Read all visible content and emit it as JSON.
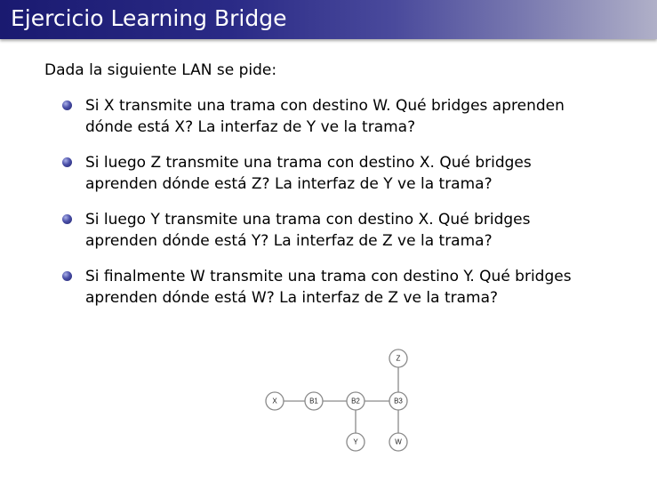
{
  "slide": {
    "title": "Ejercicio Learning Bridge",
    "intro": "Dada la siguiente LAN se pide:",
    "questions": [
      {
        "line1": "Si X transmite una trama con destino W. Qué bridges aprenden",
        "line2": "dónde está X? La interfaz de Y ve la trama?"
      },
      {
        "line1": "Si luego Z transmite una trama con destino X. Qué bridges",
        "line2": "aprenden dónde está Z? La interfaz de Y ve la trama?"
      },
      {
        "line1": "Si luego Y transmite una trama con destino X. Qué bridges",
        "line2": "aprenden dónde está Y? La interfaz de Z ve la trama?"
      },
      {
        "line1": "Si finalmente W transmite una trama con destino Y. Qué bridges",
        "line2": "aprenden dónde está W? La interfaz de Z ve la trama?"
      }
    ]
  },
  "diagram": {
    "nodes": {
      "x": "X",
      "b1": "B1",
      "b2": "B2",
      "b3": "B3",
      "y": "Y",
      "z": "Z",
      "w": "W"
    },
    "links": [
      [
        "X",
        "B1"
      ],
      [
        "B1",
        "B2"
      ],
      [
        "B2",
        "B3"
      ],
      [
        "B2",
        "Y"
      ],
      [
        "B3",
        "Z"
      ],
      [
        "B3",
        "W"
      ]
    ]
  },
  "colors": {
    "title_bar_dark": "#1a1a70",
    "title_bar_light": "#b0b0c8",
    "bullet": "#3a3d96",
    "node_stroke": "#8a8a8a"
  }
}
